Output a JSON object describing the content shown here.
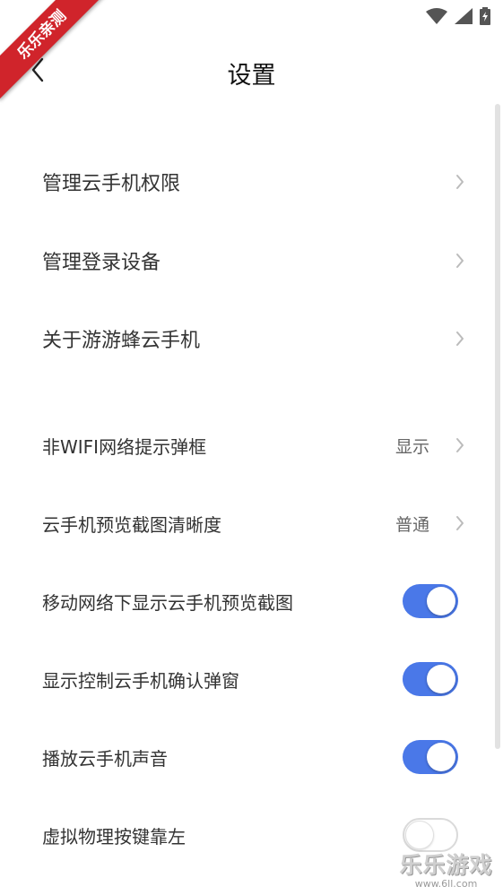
{
  "corner_badge": {
    "text": "乐乐亲测"
  },
  "header": {
    "title": "设置"
  },
  "settings": {
    "links": [
      {
        "label": "管理云手机权限"
      },
      {
        "label": "管理登录设备"
      },
      {
        "label": "关于游游蜂云手机"
      }
    ],
    "options": [
      {
        "label": "非WIFI网络提示弹框",
        "value": "显示"
      },
      {
        "label": "云手机预览截图清晰度",
        "value": "普通"
      }
    ],
    "toggles": [
      {
        "label": "移动网络下显示云手机预览截图",
        "enabled": true
      },
      {
        "label": "显示控制云手机确认弹窗",
        "enabled": true
      },
      {
        "label": "播放云手机声音",
        "enabled": true
      },
      {
        "label": "虚拟物理按键靠左",
        "enabled": false
      }
    ]
  },
  "colors": {
    "toggle_on": "#4a78e8",
    "badge": "#d0242b"
  },
  "watermark": {
    "text": "乐乐游戏",
    "url": "www.6ll.com"
  }
}
